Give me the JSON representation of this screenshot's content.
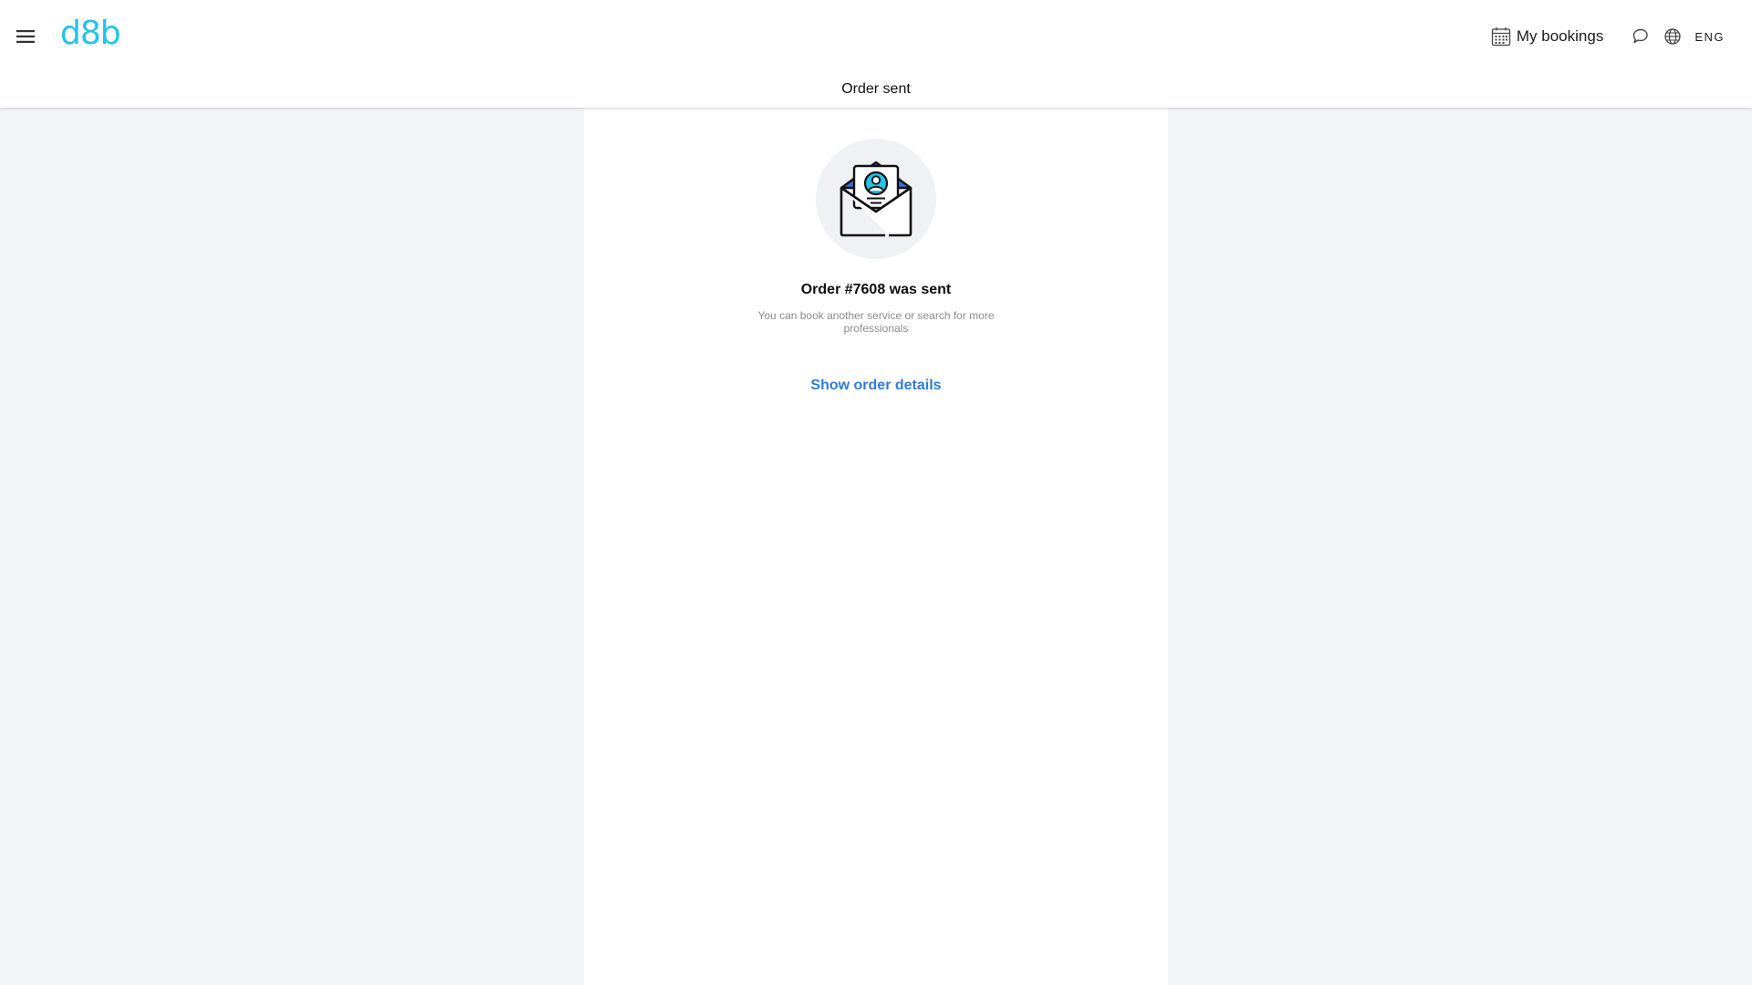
{
  "header": {
    "logo_text": "d8b",
    "my_bookings_label": "My bookings",
    "language_label": "ENG",
    "page_title": "Order sent",
    "icons": {
      "menu": "menu-icon",
      "calendar": "calendar-icon",
      "chat": "chat-icon",
      "globe": "globe-icon"
    }
  },
  "main": {
    "illustration": "envelope-with-profile-icon",
    "order_heading": "Order #7608 was sent",
    "order_subtitle": "You can book another service or search for more professionals",
    "details_link": "Show order details"
  },
  "colors": {
    "brand": "#22c4e8",
    "link": "#2f7ddc",
    "background": "#f3f5f9"
  }
}
